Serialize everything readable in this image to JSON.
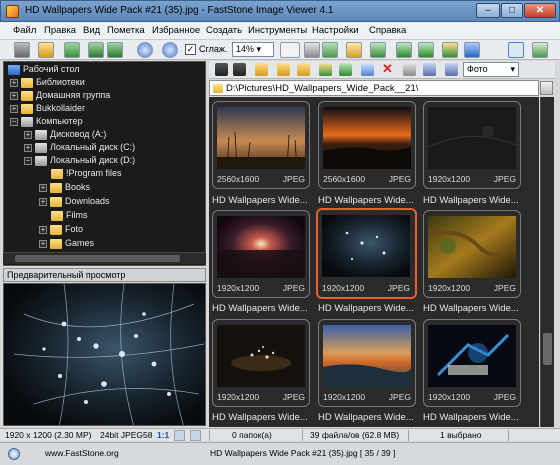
{
  "window": {
    "title": "HD Wallpapers Wide Pack #21 (35).jpg  -  FastStone Image Viewer 4.1",
    "minimize": "‒",
    "maximize": "□",
    "close": "✕"
  },
  "menu": [
    "Файл",
    "Правка",
    "Вид",
    "Пометка",
    "Избранное",
    "Создать",
    "Инструменты",
    "Настройки",
    "Справка"
  ],
  "toolbar": {
    "smooth_label": "Сглаж.",
    "smooth_checked": "✓",
    "zoom_value": "14%"
  },
  "tree": [
    {
      "label": "Рабочий стол",
      "icon": "desktop-icon"
    },
    {
      "label": "Библиотеки",
      "icon": "folder-icon",
      "expander": "+"
    },
    {
      "label": "Домашняя группа",
      "icon": "folder-icon",
      "expander": "+"
    },
    {
      "label": "Bukkollaider",
      "icon": "folder-icon",
      "expander": "+"
    },
    {
      "label": "Компьютер",
      "icon": "drive-icon",
      "expander": "−"
    },
    {
      "label": "Дисковод (A:)",
      "icon": "drive-icon",
      "expander": "+"
    },
    {
      "label": "Локальный диск (C:)",
      "icon": "drive-icon",
      "expander": "+"
    },
    {
      "label": "Локальный диск (D:)",
      "icon": "drive-icon",
      "expander": "−"
    },
    {
      "label": "!Program files",
      "icon": "folder-icon",
      "expander": ""
    },
    {
      "label": "Books",
      "icon": "folder-icon",
      "expander": "+"
    },
    {
      "label": "Downloads",
      "icon": "folder-icon",
      "expander": "+"
    },
    {
      "label": "Films",
      "icon": "folder-icon",
      "expander": ""
    },
    {
      "label": "Foto",
      "icon": "folder-icon",
      "expander": "+"
    },
    {
      "label": "Games",
      "icon": "folder-icon",
      "expander": "+"
    }
  ],
  "preview": {
    "title": "Предварительный просмотр"
  },
  "nav": {
    "view_select": "Фото",
    "path": "D:\\Pictures\\HD_Wallpapers_Wide_Pack__21\\"
  },
  "thumbnails": [
    {
      "size": "2560x1600",
      "format": "JPEG",
      "caption": "",
      "selected": false
    },
    {
      "size": "2560x1600",
      "format": "JPEG",
      "caption": "",
      "selected": false
    },
    {
      "size": "1920x1200",
      "format": "JPEG",
      "caption": "",
      "selected": false
    },
    {
      "size": "1920x1200",
      "format": "JPEG",
      "caption": "HD Wallpapers Wide...",
      "selected": false
    },
    {
      "size": "1920x1200",
      "format": "JPEG",
      "caption": "HD Wallpapers Wide...",
      "selected": true
    },
    {
      "size": "1920x1200",
      "format": "JPEG",
      "caption": "HD Wallpapers Wide...",
      "selected": false
    },
    {
      "size": "1920x1200",
      "format": "JPEG",
      "caption": "HD Wallpapers Wide...",
      "selected": false
    },
    {
      "size": "1920x1200",
      "format": "JPEG",
      "caption": "HD Wallpapers Wide...",
      "selected": false
    },
    {
      "size": "1920x1200",
      "format": "JPEG",
      "caption": "HD Wallpapers Wide...",
      "selected": false
    }
  ],
  "status": {
    "dimensions": "1920 x 1200 (2.30 MP)",
    "format": "24bit JPEG",
    "zoom": "58",
    "ratio": "1:1",
    "folders": "0 папок(а)",
    "files": "39 файла/ов (62.8 MB)",
    "selected": "1 выбрано",
    "website": "www.FastStone.org",
    "file_position": "HD Wallpapers Wide Pack #21 (35).jpg [ 35 / 39 ]"
  }
}
